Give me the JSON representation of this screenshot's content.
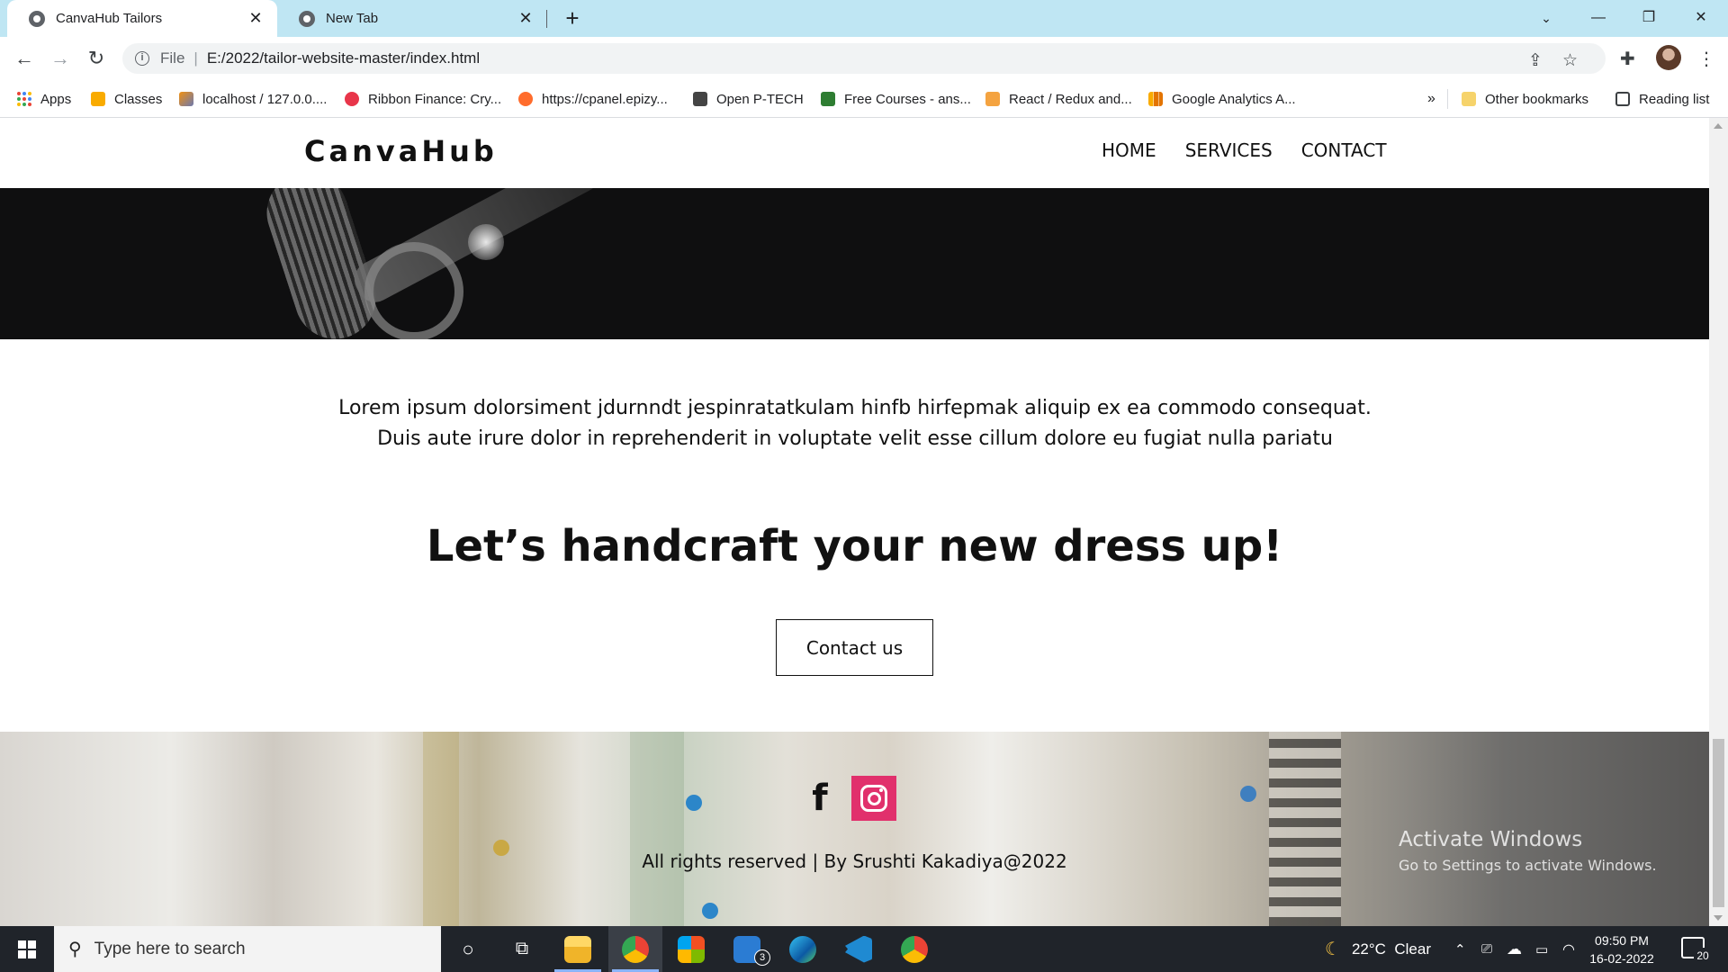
{
  "browser": {
    "tabs": [
      {
        "title": "CanvaHub Tailors",
        "active": true
      },
      {
        "title": "New Tab",
        "active": false
      }
    ],
    "url_scheme": "File",
    "url": "E:/2022/tailor-website-master/index.html",
    "bookmarks": [
      {
        "label": "Apps",
        "icon": "apps-grid-icon"
      },
      {
        "label": "Classes",
        "icon": "classroom-icon"
      },
      {
        "label": "localhost / 127.0.0....",
        "icon": "phpmyadmin-icon"
      },
      {
        "label": "Ribbon Finance: Cry...",
        "icon": "ribbon-icon"
      },
      {
        "label": "https://cpanel.epizy...",
        "icon": "cpanel-icon"
      },
      {
        "label": "Open P-TECH",
        "icon": "ptech-icon"
      },
      {
        "label": "Free Courses - ans...",
        "icon": "courses-icon"
      },
      {
        "label": "React / Redux and...",
        "icon": "react-icon"
      },
      {
        "label": "Google Analytics A...",
        "icon": "analytics-icon"
      }
    ],
    "overflow": "»",
    "other_bookmarks": "Other bookmarks",
    "reading_list": "Reading list"
  },
  "site": {
    "logo": "CanvaHub",
    "nav": [
      "HOME",
      "SERVICES",
      "CONTACT"
    ],
    "intro": "Lorem ipsum dolorsiment jdurnndt jespinratatkulam hinfb hirfepmak aliquip ex ea commodo consequat. Duis aute irure dolor in reprehenderit in voluptate velit esse cillum dolore eu fugiat nulla pariatu",
    "tagline": "Let’s handcraft your new dress up!",
    "cta": "Contact us",
    "social": {
      "facebook": "f",
      "instagram_color": "#e1306c"
    },
    "copyright": "All rights reserved | By Srushti Kakadiya@2022"
  },
  "watermark": {
    "line1": "Activate Windows",
    "line2": "Go to Settings to activate Windows."
  },
  "taskbar": {
    "search_placeholder": "Type here to search",
    "weather": "22°C  Clear",
    "time": "09:50 PM",
    "date": "16-02-2022",
    "notifications": "20",
    "mail_badge": "3"
  }
}
